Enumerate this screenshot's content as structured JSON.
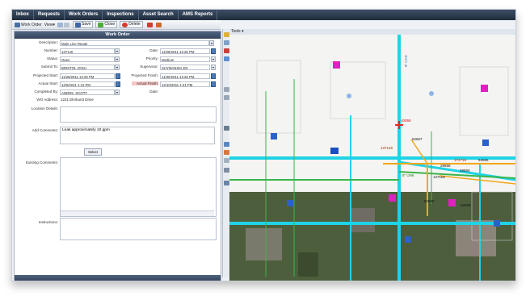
{
  "nav": {
    "tabs": [
      "Inbox",
      "Requests",
      "Work Orders",
      "Inspections",
      "Asset Search",
      "AMS Reports"
    ]
  },
  "toolbar": {
    "work_order": "Work Order",
    "view": "View",
    "save": "Save",
    "close": "Close",
    "delete": "Delete"
  },
  "panel": {
    "title": "Work Order"
  },
  "form": {
    "description_label": "Description:",
    "description": "Main Line Repair",
    "number_label": "Number:",
    "number": "137140",
    "date_label": "Date:",
    "date": "11/28/2011 12:25 PM",
    "status_label": "Status:",
    "status": "Open",
    "priority_label": "Priority:",
    "priority": "Medium",
    "submit_label": "Submit To:",
    "submit": "BRISTOL JOSH",
    "supervisor_label": "Supervisor:",
    "supervisor": "SHYMANSKI ED",
    "proj_start_label": "Projected Start:",
    "proj_start": "11/28/2011 12:25 PM",
    "proj_finish_label": "Projected Finish:",
    "proj_finish": "11/30/2011 12:25 PM",
    "act_start_label": "Actual Start:",
    "act_start": "12/6/2011 1:41 PM",
    "act_finish_label": "Actual Finish:",
    "act_finish": "12/10/2011 1:41 PM",
    "completed_label": "Completed By:",
    "completed": "ANDRS, SCOTT",
    "completed_date_label": "Date:",
    "address_label": "WO Address:",
    "address": "1221 Elmhurst Drive",
    "location_label": "Location Details:",
    "comments_label": "Add Comments:",
    "comments": "Leak approximately 10 gpm",
    "select_btn": "Select",
    "existing_label": "Existing Comments:",
    "instructions_label": "Instructions:"
  },
  "map": {
    "tools_label": "Tools",
    "labels": [
      "40059",
      "52667",
      "137146",
      "172715",
      "52665",
      "29858",
      "29859",
      "137118",
      "52668",
      "52669",
      "8\" UNK",
      "8\" CAS"
    ]
  },
  "colors": {
    "main_line": "#1fd3e6",
    "lateral": "#39b54a",
    "service": "#f3a71b",
    "marker": "#e020c0",
    "hydrant": "#2a62c9"
  }
}
